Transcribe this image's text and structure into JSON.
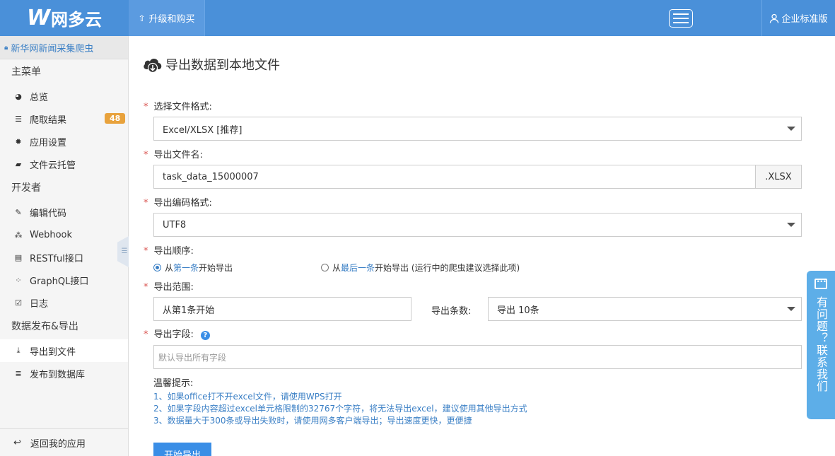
{
  "header": {
    "logo_w": "W",
    "logo_text": "网多云",
    "upgrade_label": "升级和购买",
    "edition_label": "企业标准版"
  },
  "sidebar": {
    "project_name": "新华网新闻采集爬虫",
    "main_menu_title": "主菜单",
    "main_items": [
      {
        "label": "总览",
        "icon": "dashboard-icon"
      },
      {
        "label": "爬取结果",
        "icon": "list-icon",
        "badge": "48"
      },
      {
        "label": "应用设置",
        "icon": "gear-icon"
      },
      {
        "label": "文件云托管",
        "icon": "folder-icon"
      }
    ],
    "dev_title": "开发者",
    "dev_items": [
      {
        "label": "编辑代码",
        "icon": "edit-icon"
      },
      {
        "label": "Webhook",
        "icon": "webhook-icon"
      },
      {
        "label": "RESTful接口",
        "icon": "api-icon"
      },
      {
        "label": "GraphQL接口",
        "icon": "graphql-icon"
      },
      {
        "label": "日志",
        "icon": "calendar-icon"
      }
    ],
    "publish_title": "数据发布&导出",
    "publish_items": [
      {
        "label": "导出到文件",
        "icon": "download-icon"
      },
      {
        "label": "发布到数据库",
        "icon": "database-icon"
      }
    ],
    "back_label": "返回我的应用"
  },
  "main": {
    "title": "导出数据到本地文件",
    "format_label": "选择文件格式:",
    "format_value": "Excel/XLSX [推荐]",
    "filename_label": "导出文件名:",
    "filename_value": "task_data_15000007",
    "filename_suffix": ".XLSX",
    "encoding_label": "导出编码格式:",
    "encoding_value": "UTF8",
    "order_label": "导出顺序:",
    "order_first_prefix": "从",
    "order_first_link": "第一条",
    "order_first_suffix": "开始导出",
    "order_last_prefix": "从",
    "order_last_link": "最后一条",
    "order_last_suffix": "开始导出 (运行中的爬虫建议选择此项)",
    "range_label": "导出范围:",
    "range_start": "从第1条开始",
    "count_label": "导出条数:",
    "count_value": "导出 10条",
    "fields_label": "导出字段:",
    "fields_help": "?",
    "fields_placeholder": "默认导出所有字段",
    "tips_title": "温馨提示:",
    "tips": [
      "1、如果office打不开excel文件，请使用WPS打开",
      "2、如果字段内容超过excel单元格限制的32767个字符，将无法导出excel，建议使用其他导出方式",
      "3、数据量大于300条或导出失败时，请使用网多客户端导出；导出速度更快，更便捷"
    ],
    "start_button": "开始导出"
  },
  "help_tab": {
    "text": "有问题？联系我们"
  },
  "colors": {
    "brand": "#4a90d9",
    "link": "#3a7fc5",
    "badge": "#e8a23c",
    "required": "#d9534f",
    "help_tab": "#5daee8"
  }
}
